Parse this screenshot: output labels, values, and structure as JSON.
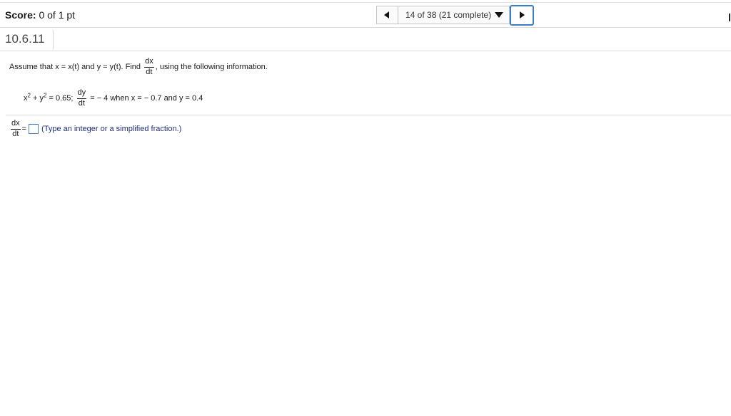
{
  "header": {
    "score_label": "Score:",
    "score_value": "0 of 1 pt",
    "nav_status": "14 of 38 (21 complete)"
  },
  "question": {
    "id": "10.6.11",
    "prompt_start": "Assume that x = x(t) and y = y(t). Find",
    "target_num": "dx",
    "target_den": "dt",
    "prompt_end": ", using the following information.",
    "given_x": "x",
    "given_exp1": "2",
    "given_plus_y": " + y",
    "given_exp2": "2",
    "given_eq": " = 0.65;",
    "given_num": "dy",
    "given_den": "dt",
    "given_rest": "= − 4 when x = − 0.7 and y = 0.4"
  },
  "answer": {
    "num": "dx",
    "den": "dt",
    "equals": "=",
    "hint": "(Type an integer or a simplified fraction.)"
  }
}
